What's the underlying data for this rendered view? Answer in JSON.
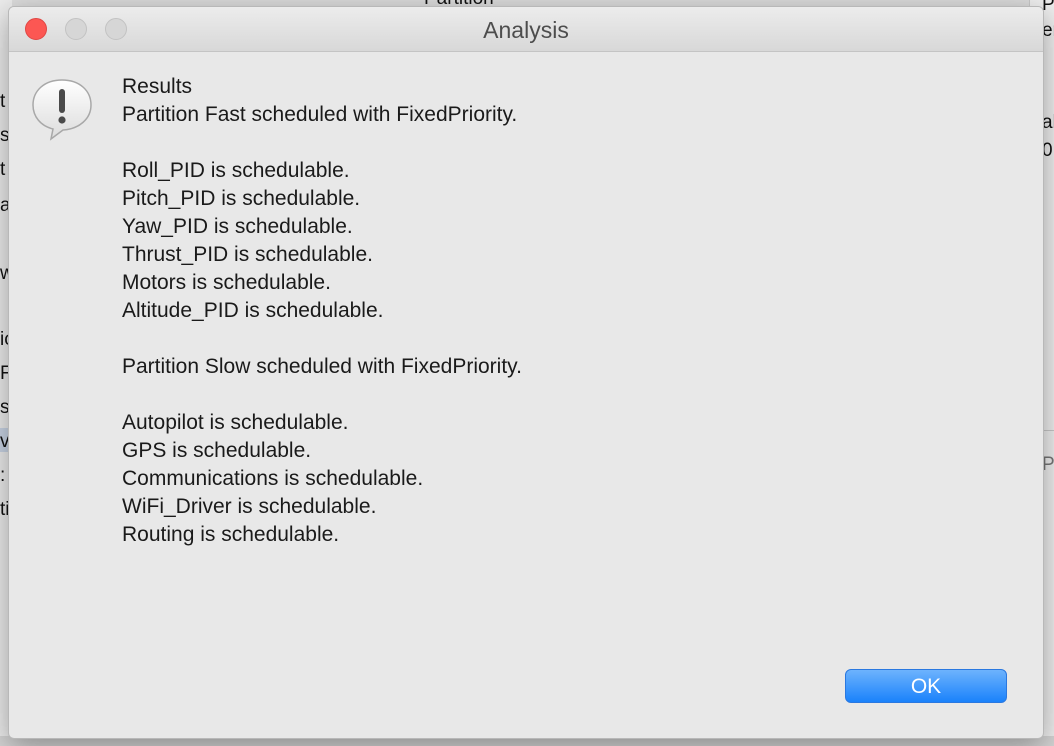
{
  "background": {
    "top_fragment": "Partition",
    "left_fragments": [
      "t",
      "s",
      "t",
      "a",
      "w",
      "ic",
      "F",
      "sl",
      "v",
      ":",
      "ti"
    ],
    "right_fragments": [
      "Pa",
      "er",
      "als",
      "0",
      "Pr"
    ]
  },
  "dialog": {
    "title": "Analysis",
    "icon": "alert-exclamation-icon",
    "message_lines": [
      "Results",
      "Partition Fast scheduled with FixedPriority.",
      "",
      "Roll_PID is schedulable.",
      "Pitch_PID is schedulable.",
      "Yaw_PID is schedulable.",
      "Thrust_PID is schedulable.",
      "Motors is schedulable.",
      "Altitude_PID is schedulable.",
      "",
      "Partition Slow scheduled with FixedPriority.",
      "",
      "Autopilot is schedulable.",
      "GPS is schedulable.",
      "Communications is schedulable.",
      "WiFi_Driver is schedulable.",
      "Routing is schedulable."
    ],
    "ok_label": "OK"
  },
  "colors": {
    "close_button": "#fc5753",
    "ok_button": "#1a82fb",
    "dialog_bg": "#e8e8e8"
  }
}
